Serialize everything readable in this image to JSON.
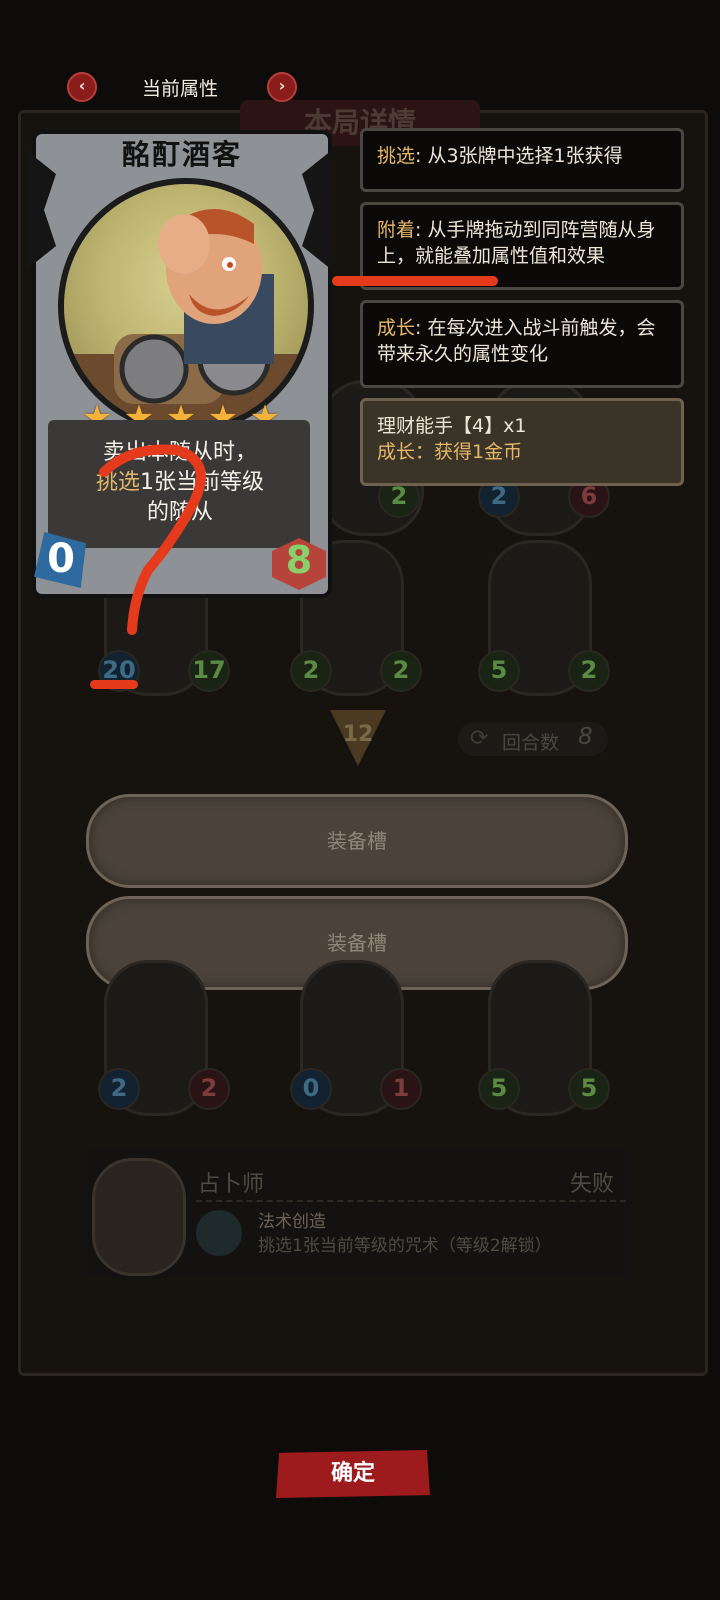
{
  "header": {
    "title": "当前属性",
    "prev_icon": "‹",
    "next_icon": "›"
  },
  "board": {
    "title": "本局详情"
  },
  "card": {
    "name": "酩酊酒客",
    "stars": 5,
    "star_glyph": "★",
    "desc_line1": "卖出本随从时，",
    "desc_keyword": "挑选",
    "desc_line2_rest": "1张当前等级",
    "desc_line3": "的随从",
    "attack": "0",
    "health": "8"
  },
  "info_panels": [
    {
      "keyword": "挑选",
      "text": ": 从3张牌中选择1张获得"
    },
    {
      "keyword": "附着",
      "text": ": 从手牌拖动到同阵营随从身上，就能叠加属性值和效果"
    },
    {
      "keyword": "成长",
      "text": ": 在每次进入战斗前触发，会带来永久的属性变化"
    }
  ],
  "bonus_panel": {
    "title": "理财能手【4】x1",
    "effect_keyword": "成长：",
    "effect_text": "获得1金币"
  },
  "board_row1": [
    {
      "a": "2"
    },
    {
      "a": "2",
      "b": "6"
    }
  ],
  "board_row2": [
    {
      "a": "20",
      "b": "17"
    },
    {
      "a": "2",
      "b": "2"
    },
    {
      "a": "5",
      "b": "2"
    }
  ],
  "tier": "12",
  "round": {
    "label": "回合数",
    "value": "8"
  },
  "equip_slots": [
    "装备槽",
    "装备槽"
  ],
  "board_row3": [
    {
      "a": "2",
      "b": "2"
    },
    {
      "a": "0",
      "b": "1"
    },
    {
      "a": "5",
      "b": "5"
    }
  ],
  "seer": {
    "name": "占卜师",
    "status": "失败",
    "skill": "法术创造",
    "skill_desc": "挑选1张当前等级的咒术（等级2解锁）"
  },
  "confirm_label": "确定",
  "colors": {
    "accent_red": "#9e1b1d",
    "keyword_gold": "#e5b768",
    "annotation": "#e53a1c"
  }
}
